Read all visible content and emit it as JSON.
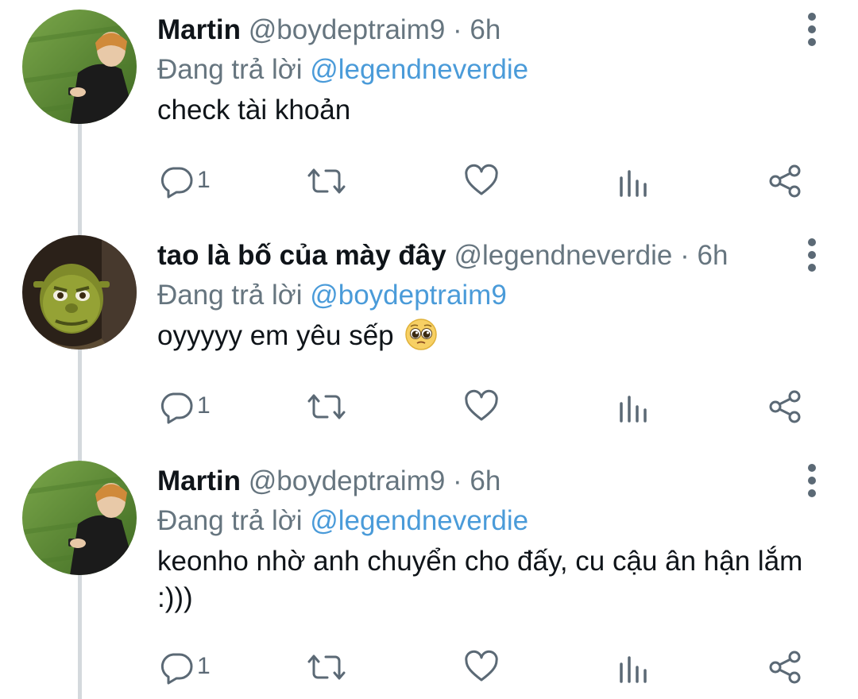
{
  "tweets": [
    {
      "name": "Martin",
      "meta": "@boydeptraim9 · 6h",
      "reply_prefix": "Đang trả lời",
      "reply_to": "@legendneverdie",
      "text": "check tài khoản",
      "reply_count": "1",
      "avatar": "grass-photo-avatar"
    },
    {
      "name": "tao là bố của mày đây",
      "meta": "@legendneverdie · 6h",
      "reply_prefix": "Đang trả lời",
      "reply_to": "@boydeptraim9",
      "text": "oyyyyy em yêu sếp",
      "emoji": "pleading-face-emoji",
      "reply_count": "1",
      "avatar": "shrek-avatar"
    },
    {
      "name": "Martin",
      "meta": "@boydeptraim9 · 6h",
      "reply_prefix": "Đang trả lời",
      "reply_to": "@legendneverdie",
      "text": "keonho nhờ anh chuyển cho đấy, cu cậu ân hận lắm :)))",
      "reply_count": "1",
      "avatar": "grass-photo-avatar"
    }
  ],
  "icons": [
    "reply-icon",
    "retweet-icon",
    "like-icon",
    "stats-icon",
    "share-icon",
    "more-icon"
  ],
  "colors": {
    "mention": "#4a9bd9",
    "secondary_text": "#66757f",
    "icon": "#5b6975",
    "thread_line": "#d4d9dd"
  }
}
